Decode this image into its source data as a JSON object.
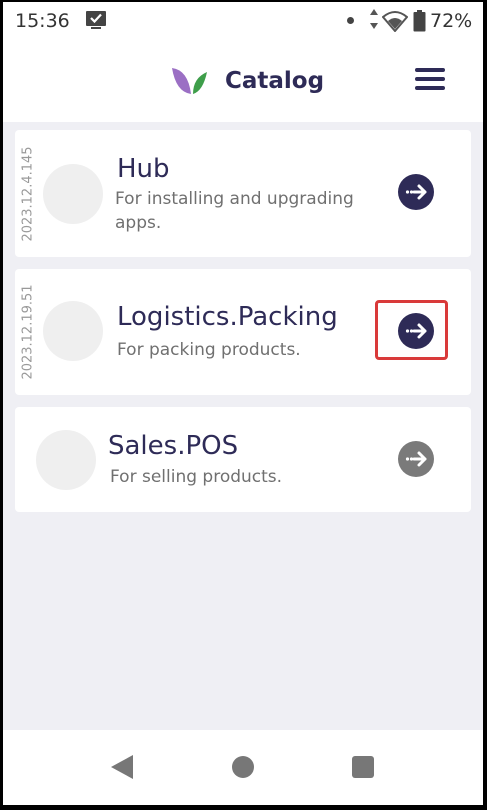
{
  "status_bar": {
    "time": "15:36",
    "battery": "72%",
    "icons": [
      "checkbox-notification-icon",
      "dot-icon",
      "data-arrows-icon",
      "wifi-icon",
      "battery-icon"
    ]
  },
  "app_bar": {
    "title": "Catalog",
    "logo_icon": "leaf-logo",
    "menu_icon": "hamburger-menu-icon"
  },
  "colors": {
    "primary": "#2e2b57",
    "logo_purple": "#9b6fc4",
    "logo_green": "#3e9e4a",
    "background": "#efeff4",
    "highlight": "#d93a3a",
    "disabled_button": "#7a7a7a"
  },
  "apps": [
    {
      "version": "2023.12.4.145",
      "name": "Hub",
      "description": "For installing and upgrading apps.",
      "action_icon": "arrow-right-circle-icon"
    },
    {
      "version": "2023.12.19.51",
      "name": "Logistics.Packing",
      "description": "For packing products.",
      "action_icon": "arrow-right-circle-icon",
      "highlighted": true
    },
    {
      "version": "",
      "name": "Sales.POS",
      "description": "For selling products.",
      "action_icon": "arrow-right-circle-icon"
    }
  ],
  "nav_bar": {
    "icons": [
      "back-icon",
      "home-icon",
      "recents-icon"
    ]
  }
}
